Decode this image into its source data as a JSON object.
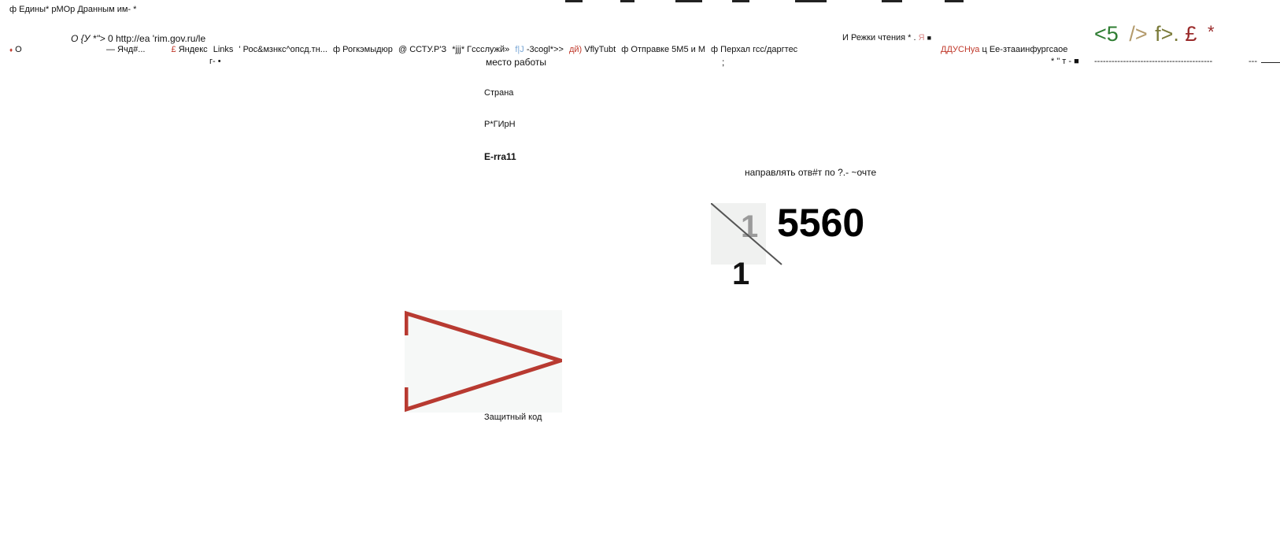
{
  "window": {
    "title_fragment": "ф Едины* рМОр Дранным им- *"
  },
  "address_bar": {
    "prefix": "О {У *\">",
    "zero": "0",
    "url": "http://ea 'rim.gov.ru/le"
  },
  "reader_area": {
    "label": "И Режки чтения * .",
    "marker": "Я",
    "square": "■"
  },
  "toolbar_icons": {
    "a": "<5",
    "b": "/>",
    "c": "f>.",
    "d": "£",
    "e": "*"
  },
  "bookmarks_bar": {
    "lead_icon": "♦",
    "lead_label": "О",
    "items": [
      {
        "icon": "",
        "label": "— Ячд#..."
      },
      {
        "icon": "£",
        "label": "Яндекс"
      },
      {
        "icon": "",
        "label": "Links"
      },
      {
        "icon": "",
        "label": "' Рос&мзнкс^опсд.тн..."
      },
      {
        "icon": "ф",
        "label": "Рогкэмыдюр"
      },
      {
        "icon": "@",
        "label": "ССТУ.Р'З"
      },
      {
        "icon": "",
        "label": "*jjj* Гссслужй»"
      },
      {
        "icon": "f|J",
        "label": "-3cogl*>>"
      },
      {
        "icon": "дй)",
        "label": "VflyTubt"
      },
      {
        "icon": "ф",
        "label": "Отправке 5М5 и М"
      },
      {
        "icon": "ф",
        "label": "Перхал гсс/даргтес"
      }
    ],
    "right_items": [
      {
        "icon": "",
        "label": "ДДУСНуа"
      },
      {
        "icon": "ц",
        "label": "Ее-зтааинфургсаое"
      }
    ]
  },
  "subbar": {
    "left_fragment": "г- •",
    "right_fragment": "* \" т - ■",
    "dashes": "-----------------------------------------",
    "tail_dashes": "---"
  },
  "form": {
    "field_workplace": "место работы",
    "semicolon": ";",
    "field_country": "Страна",
    "field_region": "Р*ГИрН",
    "field_email": "E-rra11",
    "reply_option": "направлять отв#т по ?.- ~очте"
  },
  "captcha": {
    "code_visible": "5560",
    "code_second_line": "1",
    "code_obscured_digit": "1",
    "label": "Защитный код"
  },
  "colors": {
    "accent_red": "#c0392b",
    "play_stroke": "#b83a31",
    "toolbar_green": "#2e7d32",
    "toolbar_tan": "#b39a6b",
    "toolbar_olive": "#7b7b3a",
    "toolbar_maroon": "#9a2b2b"
  }
}
